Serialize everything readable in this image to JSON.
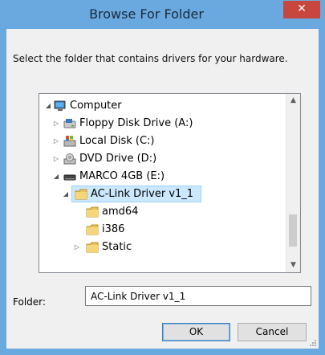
{
  "dialog": {
    "title": "Browse For Folder",
    "close_glyph": "✕",
    "prompt": "Select the folder that contains drivers for your hardware."
  },
  "tree": {
    "items": [
      {
        "label": "Computer",
        "icon": "computer-icon",
        "expander": "expanded"
      },
      {
        "label": "Floppy Disk Drive (A:)",
        "icon": "floppy-drive-icon",
        "expander": "collapsed"
      },
      {
        "label": "Local Disk (C:)",
        "icon": "local-disk-icon",
        "expander": "collapsed"
      },
      {
        "label": "DVD Drive (D:)",
        "icon": "dvd-drive-icon",
        "expander": "collapsed"
      },
      {
        "label": "MARCO 4GB (E:)",
        "icon": "usb-drive-icon",
        "expander": "expanded"
      },
      {
        "label": "AC-Link Driver v1_1",
        "icon": "folder-icon",
        "expander": "expanded",
        "selected": true
      },
      {
        "label": "amd64",
        "icon": "folder-icon",
        "expander": "none"
      },
      {
        "label": "i386",
        "icon": "folder-icon",
        "expander": "none"
      },
      {
        "label": "Static",
        "icon": "folder-icon",
        "expander": "collapsed"
      }
    ]
  },
  "folder_field": {
    "label": "Folder:",
    "value": "AC-Link Driver v1_1"
  },
  "buttons": {
    "ok": "OK",
    "cancel": "Cancel"
  },
  "colors": {
    "title_bar": "#6aa9e0",
    "close_button": "#c7463e",
    "selection": "#cce8ff"
  }
}
